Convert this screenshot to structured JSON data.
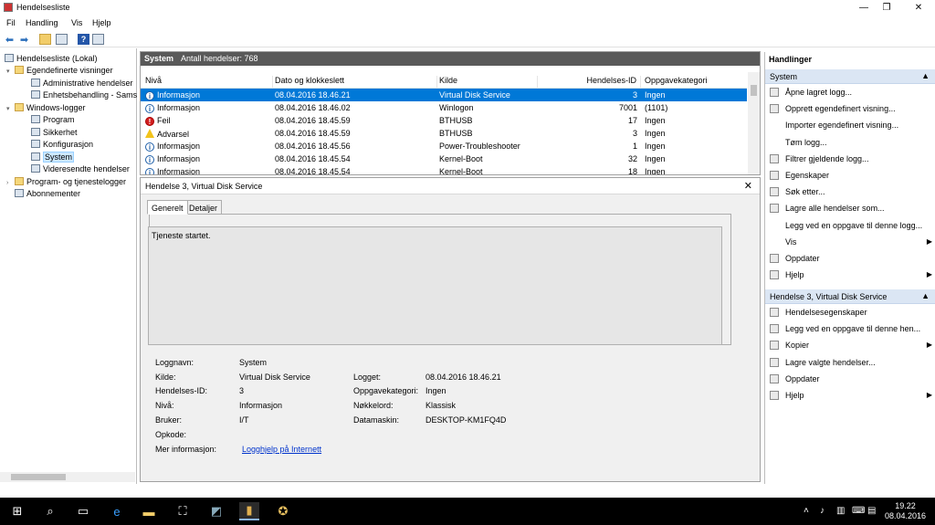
{
  "window": {
    "title": "Hendelsesliste",
    "controls": {
      "minimize": "—",
      "maximize": "❐",
      "close": "✕"
    }
  },
  "menu": [
    "Fil",
    "Handling",
    "Vis",
    "Hjelp"
  ],
  "toolbar": {
    "icons": [
      "back-icon",
      "forward-icon",
      "folder-up-icon",
      "console-tree-icon",
      "help-icon",
      "properties-icon"
    ]
  },
  "tree": {
    "items": [
      {
        "label": "Hendelsesliste (Lokal)",
        "level": 0
      },
      {
        "label": "Egendefinerte visninger",
        "level": 1,
        "expand": "▾"
      },
      {
        "label": "Administrative hendelser",
        "level": 2
      },
      {
        "label": "Enhetsbehandling - Sams",
        "level": 2
      },
      {
        "label": "Windows-logger",
        "level": 1,
        "expand": "▾"
      },
      {
        "label": "Program",
        "level": 2
      },
      {
        "label": "Sikkerhet",
        "level": 2
      },
      {
        "label": "Konfigurasjon",
        "level": 2
      },
      {
        "label": "System",
        "level": 2,
        "selected": true
      },
      {
        "label": "Videresendte hendelser",
        "level": 2
      },
      {
        "label": "Program- og tjenestelogger",
        "level": 1,
        "expand": "›"
      },
      {
        "label": "Abonnementer",
        "level": 1
      }
    ]
  },
  "events": {
    "log_name": "System",
    "count_label": "Antall hendelser: 768",
    "columns": [
      "Nivå",
      "Dato og klokkeslett",
      "Kilde",
      "Hendelses-ID",
      "Oppgavekategori"
    ],
    "rows": [
      {
        "level": "Informasjon",
        "type": "info",
        "date": "08.04.2016 18.46.21",
        "source": "Virtual Disk Service",
        "id": "3",
        "category": "Ingen"
      },
      {
        "level": "Informasjon",
        "type": "info",
        "date": "08.04.2016 18.46.02",
        "source": "Winlogon",
        "id": "7001",
        "category": "(1101)"
      },
      {
        "level": "Feil",
        "type": "error",
        "date": "08.04.2016 18.45.59",
        "source": "BTHUSB",
        "id": "17",
        "category": "Ingen"
      },
      {
        "level": "Advarsel",
        "type": "warning",
        "date": "08.04.2016 18.45.59",
        "source": "BTHUSB",
        "id": "3",
        "category": "Ingen"
      },
      {
        "level": "Informasjon",
        "type": "info",
        "date": "08.04.2016 18.45.56",
        "source": "Power-Troubleshooter",
        "id": "1",
        "category": "Ingen"
      },
      {
        "level": "Informasjon",
        "type": "info",
        "date": "08.04.2016 18.45.54",
        "source": "Kernel-Boot",
        "id": "32",
        "category": "Ingen"
      },
      {
        "level": "Informasjon",
        "type": "info",
        "date": "08.04.2016 18.45.54",
        "source": "Kernel-Boot",
        "id": "18",
        "category": "Ingen"
      }
    ]
  },
  "detail": {
    "title": "Hendelse 3, Virtual Disk Service",
    "tabs": [
      "Generelt",
      "Detaljer"
    ],
    "description": "Tjeneste startet.",
    "labels": {
      "log_name": "Loggnavn:",
      "source": "Kilde:",
      "event_id": "Hendelses-ID:",
      "level": "Nivå:",
      "user": "Bruker:",
      "opcode": "Opkode:",
      "more_info": "Mer informasjon:",
      "logged": "Logget:",
      "task_category": "Oppgavekategori:",
      "keywords": "Nøkkelord:",
      "computer": "Datamaskin:"
    },
    "values": {
      "log_name": "System",
      "source": "Virtual Disk Service",
      "event_id": "3",
      "level": "Informasjon",
      "user": "I/T",
      "opcode": "",
      "more_info_link": "Logghjelp på Internett",
      "logged": "08.04.2016 18.46.21",
      "task_category": "Ingen",
      "keywords": "Klassisk",
      "computer": "DESKTOP-KM1FQ4D"
    }
  },
  "actions": {
    "header": "Handlinger",
    "section1": {
      "title": "System",
      "items": [
        {
          "label": "Åpne lagret logg...",
          "icon": "open-folder-icon"
        },
        {
          "label": "Opprett egendefinert visning...",
          "icon": "filter-icon"
        },
        {
          "label": "Importer egendefinert visning...",
          "icon": ""
        },
        {
          "label": "Tøm logg...",
          "icon": ""
        },
        {
          "label": "Filtrer gjeldende logg...",
          "icon": "filter-icon"
        },
        {
          "label": "Egenskaper",
          "icon": "properties-icon"
        },
        {
          "label": "Søk etter...",
          "icon": "find-icon"
        },
        {
          "label": "Lagre alle hendelser som...",
          "icon": "save-icon"
        },
        {
          "label": "Legg ved en oppgave til denne logg...",
          "icon": ""
        },
        {
          "label": "Vis",
          "icon": "",
          "submenu": true
        },
        {
          "label": "Oppdater",
          "icon": "refresh-icon"
        },
        {
          "label": "Hjelp",
          "icon": "help-icon",
          "submenu": true
        }
      ]
    },
    "section2": {
      "title": "Hendelse 3, Virtual Disk Service",
      "items": [
        {
          "label": "Hendelsesegenskaper",
          "icon": "event-properties-icon"
        },
        {
          "label": "Legg ved en oppgave til denne hen...",
          "icon": "task-icon"
        },
        {
          "label": "Kopier",
          "icon": "copy-icon",
          "submenu": true
        },
        {
          "label": "Lagre valgte hendelser...",
          "icon": "save-icon"
        },
        {
          "label": "Oppdater",
          "icon": "refresh-icon"
        },
        {
          "label": "Hjelp",
          "icon": "help-icon",
          "submenu": true
        }
      ]
    }
  },
  "taskbar": {
    "time": "19.22",
    "date": "08.04.2016"
  },
  "colors": {
    "selection": "#0078d7",
    "header_dark": "#595959",
    "actions_header": "#dbe6f4",
    "taskbar": "#000000"
  }
}
